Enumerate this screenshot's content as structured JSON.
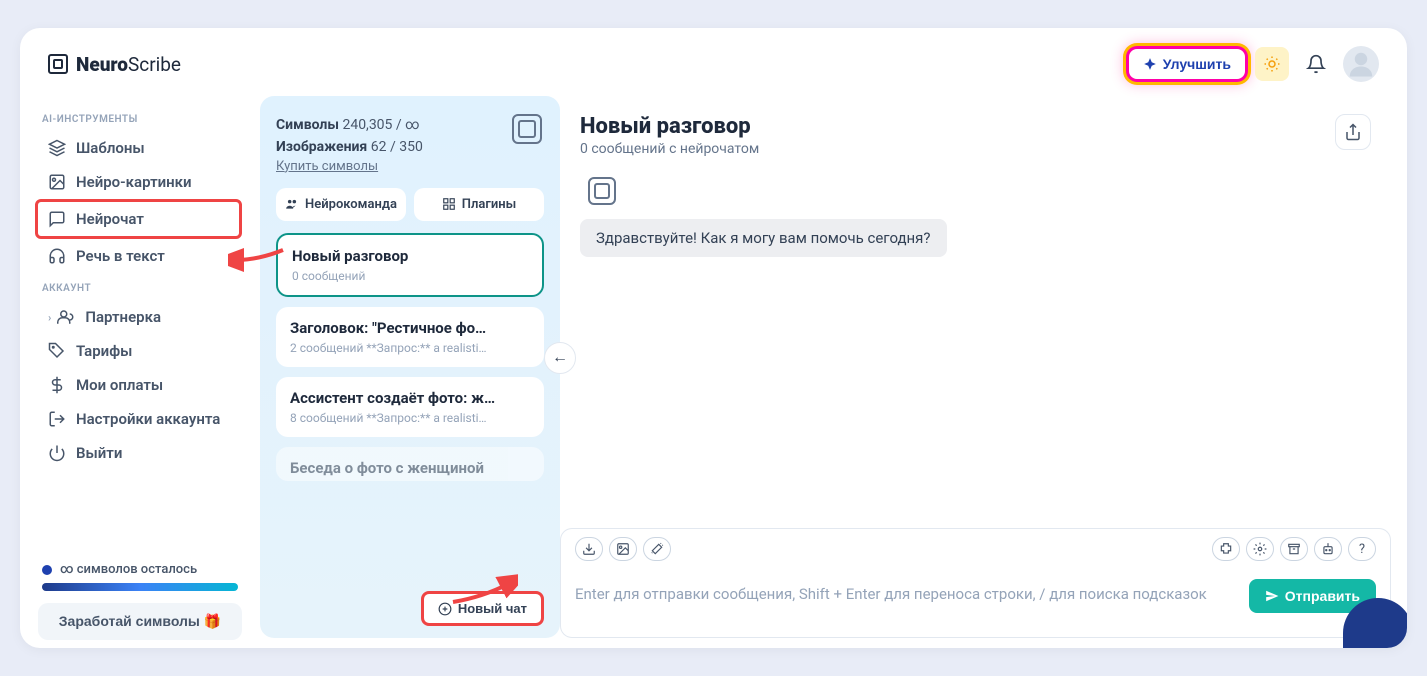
{
  "logo": {
    "brand": "Neuro",
    "brand2": "Scribe"
  },
  "header": {
    "upgrade": "Улучшить"
  },
  "sidebar": {
    "section1": "AI-ИНСТРУМЕНТЫ",
    "items1": [
      {
        "label": "Шаблоны"
      },
      {
        "label": "Нейро-картинки"
      },
      {
        "label": "Нейрочат"
      },
      {
        "label": "Речь в текст"
      }
    ],
    "section2": "АККАУНТ",
    "items2": [
      {
        "label": "Партнерка"
      },
      {
        "label": "Тарифы"
      },
      {
        "label": "Мои оплаты"
      },
      {
        "label": "Настройки аккаунта"
      },
      {
        "label": "Выйти"
      }
    ],
    "infinity": "∞ символов осталось",
    "earn": "Заработай символы 🎁"
  },
  "chatlist": {
    "symbols_label": "Символы",
    "symbols_value": "240,305 / ∞",
    "images_label": "Изображения",
    "images_value": "62 / 350",
    "buy": "Купить символы",
    "tab1": "Нейрокоманда",
    "tab2": "Плагины",
    "convos": [
      {
        "title": "Новый разговор",
        "sub": "0 сообщений"
      },
      {
        "title": "Заголовок: \"Рестичное фо…",
        "sub": "2 сообщений   **Запрос:** a realisti…"
      },
      {
        "title": "Ассистент создаёт фото: ж…",
        "sub": "8 сообщений   **Запрос:** a realisti…"
      },
      {
        "title": "Беседа о фото с женщиной",
        "sub": ""
      }
    ],
    "new_chat": "Новый чат"
  },
  "main": {
    "title": "Новый разговор",
    "subtitle": "0 сообщений с нейрочатом",
    "greeting": "Здравствуйте! Как я могу вам помочь сегодня?",
    "placeholder": "Enter для отправки сообщения, Shift + Enter для переноса строки, / для поиска подсказок",
    "send": "Отправить",
    "help": "?"
  }
}
